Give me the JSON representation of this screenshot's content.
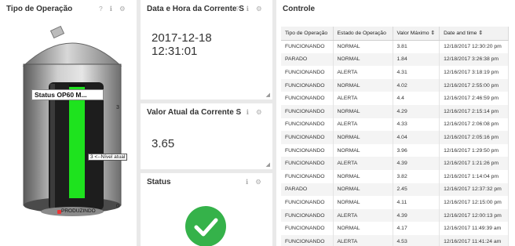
{
  "widgets": {
    "operation_type": {
      "title": "Tipo de Operação"
    },
    "datetime": {
      "title": "Data e Hora da Corrente S",
      "value": "2017-12-18\n12:31:01"
    },
    "current_value": {
      "title": "Valor Atual da Corrente S",
      "value": "3.65"
    },
    "status": {
      "title": "Status",
      "state": "ok",
      "color": "#35b24a"
    },
    "control": {
      "title": "Controle"
    }
  },
  "widget_icons": {
    "help": "?",
    "info": "ℹ",
    "settings": "⚙",
    "resize": "◢"
  },
  "silo": {
    "label": "Status OP60 M...",
    "level_label": "3 <--Nível atual",
    "scale_max": "3",
    "scale_min": "0",
    "state_text": "PRODUZINDO",
    "fill_level": 0.98,
    "fill_color": "#1ee31e"
  },
  "table": {
    "columns": [
      "Tipo de Operação",
      "Estado de Operação",
      "Valor Máximo ⇕",
      "Date and time ⇕"
    ],
    "rows": [
      [
        "FUNCIONANDO",
        "NORMAL",
        "3.81",
        "12/18/2017 12:30:20 pm"
      ],
      [
        "PARADO",
        "NORMAL",
        "1.84",
        "12/18/2017 3:26:38 pm"
      ],
      [
        "FUNCIONANDO",
        "ALERTA",
        "4.31",
        "12/16/2017 3:18:19 pm"
      ],
      [
        "FUNCIONANDO",
        "NORMAL",
        "4.02",
        "12/16/2017 2:55:00 pm"
      ],
      [
        "FUNCIONANDO",
        "ALERTA",
        "4.4",
        "12/16/2017 2:46:59 pm"
      ],
      [
        "FUNCIONANDO",
        "NORMAL",
        "4.29",
        "12/16/2017 2:15:14 pm"
      ],
      [
        "FUNCIONANDO",
        "ALERTA",
        "4.33",
        "12/16/2017 2:06:08 pm"
      ],
      [
        "FUNCIONANDO",
        "NORMAL",
        "4.04",
        "12/16/2017 2:05:16 pm"
      ],
      [
        "FUNCIONANDO",
        "NORMAL",
        "3.96",
        "12/16/2017 1:29:50 pm"
      ],
      [
        "FUNCIONANDO",
        "ALERTA",
        "4.39",
        "12/16/2017 1:21:26 pm"
      ],
      [
        "FUNCIONANDO",
        "NORMAL",
        "3.82",
        "12/16/2017 1:14:04 pm"
      ],
      [
        "PARADO",
        "NORMAL",
        "2.45",
        "12/16/2017 12:37:32 pm"
      ],
      [
        "FUNCIONANDO",
        "NORMAL",
        "4.11",
        "12/16/2017 12:15:00 pm"
      ],
      [
        "FUNCIONANDO",
        "ALERTA",
        "4.39",
        "12/16/2017 12:00:13 pm"
      ],
      [
        "FUNCIONANDO",
        "NORMAL",
        "4.17",
        "12/16/2017 11:49:39 am"
      ],
      [
        "FUNCIONANDO",
        "ALERTA",
        "4.53",
        "12/16/2017 11:41:24 am"
      ]
    ]
  }
}
